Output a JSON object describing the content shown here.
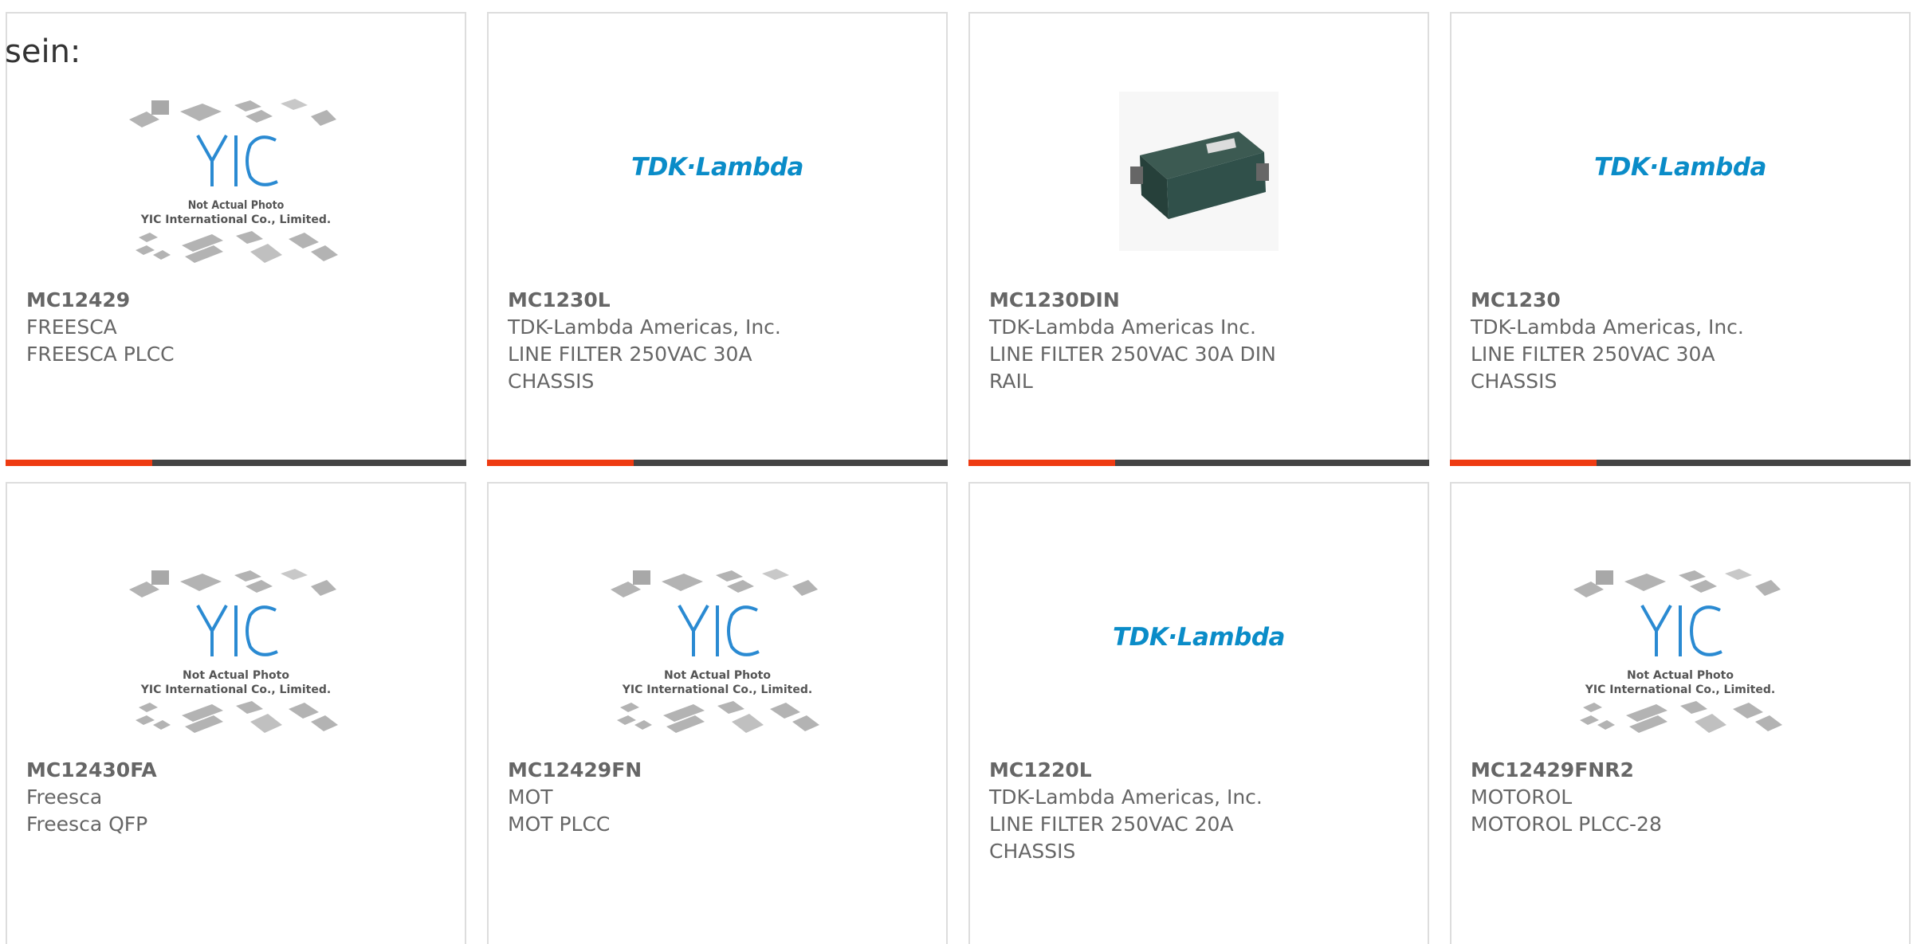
{
  "heading": "sein:",
  "placeholder": {
    "logo_text": "YIC",
    "caption_line1": "Not Actual Photo",
    "caption_line2": "YIC International Co., Limited."
  },
  "brand_logo_text": "TDK·Lambda",
  "colors": {
    "accent": "#ee3b12",
    "bar": "#444444",
    "tdk_blue": "#0a8cc8",
    "yic_blue": "#2a8ad2"
  },
  "products": [
    {
      "part": "MC12429",
      "manufacturer": "FREESCA",
      "desc": [
        "FREESCA PLCC"
      ],
      "image": "yic-placeholder"
    },
    {
      "part": "MC1230L",
      "manufacturer": "TDK-Lambda Americas, Inc.",
      "desc": [
        "LINE FILTER 250VAC 30A",
        "CHASSIS"
      ],
      "image": "tdk-lambda-logo"
    },
    {
      "part": "MC1230DIN",
      "manufacturer": "TDK-Lambda Americas Inc.",
      "desc": [
        "LINE FILTER 250VAC 30A DIN",
        "RAIL"
      ],
      "image": "line-filter-photo"
    },
    {
      "part": "MC1230",
      "manufacturer": "TDK-Lambda Americas, Inc.",
      "desc": [
        "LINE FILTER 250VAC 30A",
        "CHASSIS"
      ],
      "image": "tdk-lambda-logo"
    },
    {
      "part": "MC12430FA",
      "manufacturer": "Freesca",
      "desc": [
        "Freesca QFP"
      ],
      "image": "yic-placeholder"
    },
    {
      "part": "MC12429FN",
      "manufacturer": "MOT",
      "desc": [
        "MOT PLCC"
      ],
      "image": "yic-placeholder"
    },
    {
      "part": "MC1220L",
      "manufacturer": "TDK-Lambda Americas, Inc.",
      "desc": [
        "LINE FILTER 250VAC 20A",
        "CHASSIS"
      ],
      "image": "tdk-lambda-logo"
    },
    {
      "part": "MC12429FNR2",
      "manufacturer": "MOTOROL",
      "desc": [
        "MOTOROL PLCC-28"
      ],
      "image": "yic-placeholder"
    }
  ]
}
